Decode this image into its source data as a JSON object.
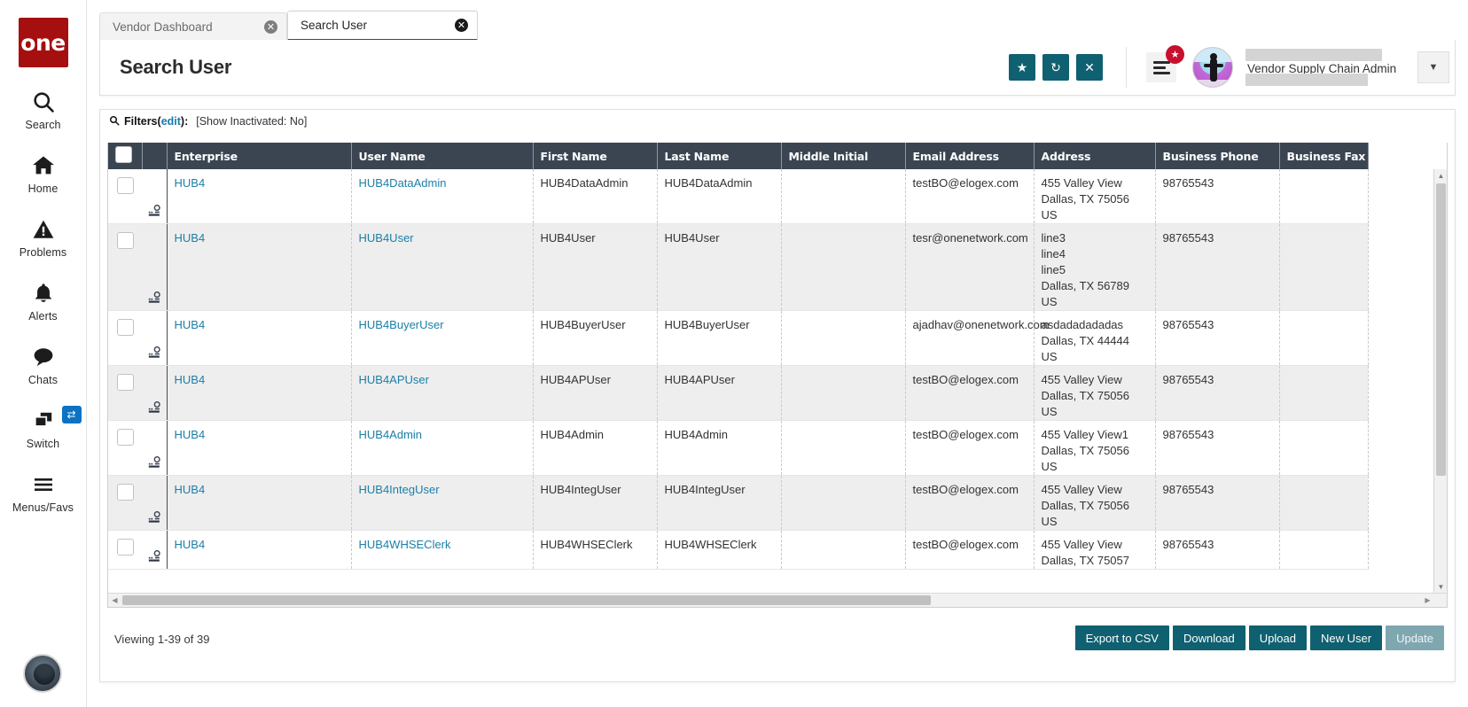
{
  "brand": {
    "logo_text": "one",
    "accent": "#0f6070",
    "logo_bg": "#a50f0f"
  },
  "rail": {
    "items": [
      {
        "label": "Search",
        "icon": "search-icon"
      },
      {
        "label": "Home",
        "icon": "home-icon"
      },
      {
        "label": "Problems",
        "icon": "warning-icon"
      },
      {
        "label": "Alerts",
        "icon": "bell-icon"
      },
      {
        "label": "Chats",
        "icon": "chat-icon"
      },
      {
        "label": "Switch",
        "icon": "switch-icon",
        "badge": "⇄"
      },
      {
        "label": "Menus/Favs",
        "icon": "hamburger-icon"
      }
    ]
  },
  "tabs": [
    {
      "label": "Vendor Dashboard",
      "active": false,
      "close": "✕"
    },
    {
      "label": "Search User",
      "active": true,
      "close": "✕"
    }
  ],
  "header": {
    "title": "Search User",
    "actions": [
      {
        "name": "favorite-button",
        "glyph": "★"
      },
      {
        "name": "refresh-button",
        "glyph": "↻"
      },
      {
        "name": "close-button",
        "glyph": "✕"
      }
    ],
    "menu_badge": "★",
    "user_role": "Vendor Supply Chain Admin",
    "chevron": "▼"
  },
  "filters": {
    "icon": "search-icon",
    "label": "Filters",
    "open_paren": "(",
    "edit": "edit",
    "close_paren": "):",
    "criteria": "[Show Inactivated: No]"
  },
  "table": {
    "columns": [
      "Enterprise",
      "User Name",
      "First Name",
      "Last Name",
      "Middle Initial",
      "Email Address",
      "Address",
      "Business Phone",
      "Business Fax"
    ],
    "rows": [
      {
        "enterprise": "HUB4",
        "user_name": "HUB4DataAdmin",
        "first_name": "HUB4DataAdmin",
        "last_name": "HUB4DataAdmin",
        "middle_initial": "",
        "email": "testBO@elogex.com",
        "address": [
          "455 Valley View",
          "Dallas, TX 75056",
          "US"
        ],
        "business_phone": "98765543",
        "business_fax": ""
      },
      {
        "enterprise": "HUB4",
        "user_name": "HUB4User",
        "first_name": "HUB4User",
        "last_name": "HUB4User",
        "middle_initial": "",
        "email": "tesr@onenetwork.com",
        "address": [
          "line3",
          "line4",
          "line5",
          "Dallas, TX 56789",
          "US"
        ],
        "business_phone": "98765543",
        "business_fax": ""
      },
      {
        "enterprise": "HUB4",
        "user_name": "HUB4BuyerUser",
        "first_name": "HUB4BuyerUser",
        "last_name": "HUB4BuyerUser",
        "middle_initial": "",
        "email": "ajadhav@onenetwork.com",
        "address": [
          "asdadadadadas",
          "Dallas, TX 44444",
          "US"
        ],
        "business_phone": "98765543",
        "business_fax": ""
      },
      {
        "enterprise": "HUB4",
        "user_name": "HUB4APUser",
        "first_name": "HUB4APUser",
        "last_name": "HUB4APUser",
        "middle_initial": "",
        "email": "testBO@elogex.com",
        "address": [
          "455 Valley View",
          "Dallas, TX 75056",
          "US"
        ],
        "business_phone": "98765543",
        "business_fax": ""
      },
      {
        "enterprise": "HUB4",
        "user_name": "HUB4Admin",
        "first_name": "HUB4Admin",
        "last_name": "HUB4Admin",
        "middle_initial": "",
        "email": "testBO@elogex.com",
        "address": [
          "455 Valley View1",
          "Dallas, TX 75056",
          "US"
        ],
        "business_phone": "98765543",
        "business_fax": ""
      },
      {
        "enterprise": "HUB4",
        "user_name": "HUB4IntegUser",
        "first_name": "HUB4IntegUser",
        "last_name": "HUB4IntegUser",
        "middle_initial": "",
        "email": "testBO@elogex.com",
        "address": [
          "455 Valley View",
          "Dallas, TX 75056",
          "US"
        ],
        "business_phone": "98765543",
        "business_fax": ""
      },
      {
        "enterprise": "HUB4",
        "user_name": "HUB4WHSEClerk",
        "first_name": "HUB4WHSEClerk",
        "last_name": "HUB4WHSEClerk",
        "middle_initial": "",
        "email": "testBO@elogex.com",
        "address": [
          "455 Valley View",
          "Dallas, TX 75057"
        ],
        "business_phone": "98765543",
        "business_fax": ""
      }
    ]
  },
  "footer": {
    "viewing": "Viewing 1-39 of 39",
    "buttons": [
      {
        "label": "Export to CSV",
        "disabled": false
      },
      {
        "label": "Download",
        "disabled": false
      },
      {
        "label": "Upload",
        "disabled": false
      },
      {
        "label": "New User",
        "disabled": false
      },
      {
        "label": "Update",
        "disabled": true
      }
    ]
  }
}
